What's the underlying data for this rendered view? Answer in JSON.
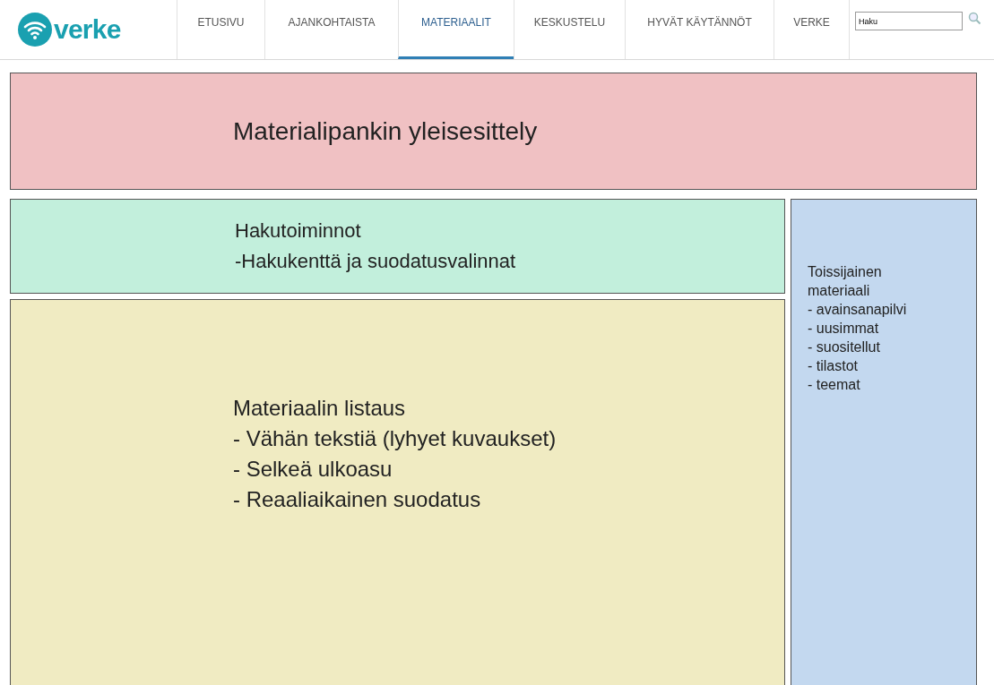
{
  "logo": {
    "text": "verke"
  },
  "nav": [
    {
      "label": "ETUSIVU",
      "selected": false
    },
    {
      "label": "AJANKOHTAISTA",
      "selected": false
    },
    {
      "label": "MATERIAALIT",
      "selected": true
    },
    {
      "label": "KESKUSTELU",
      "selected": false
    },
    {
      "label": "HYVÄT KÄYTÄNNÖT",
      "selected": false
    },
    {
      "label": "VERKE",
      "selected": false
    }
  ],
  "search": {
    "value": "Haku"
  },
  "blocks": [
    {
      "kind": "intro",
      "lines": [
        "Materialipankin yleisesittely"
      ]
    },
    {
      "kind": "search",
      "lines": [
        "Hakutoiminnot",
        "-Hakukenttä ja suodatusvalinnat"
      ]
    },
    {
      "kind": "listing",
      "lines": [
        "Materiaalin listaus",
        "- Vähän tekstiä (lyhyet kuvaukset)",
        "- Selkeä ulkoasu",
        "- Reaaliaikainen suodatus"
      ]
    },
    {
      "kind": "sidebar",
      "lines": [
        "Toissijainen",
        "materiaali",
        "- avainsanapilvi",
        "- uusimmat",
        "- suositellut",
        "- tilastot",
        "- teemat"
      ]
    }
  ]
}
